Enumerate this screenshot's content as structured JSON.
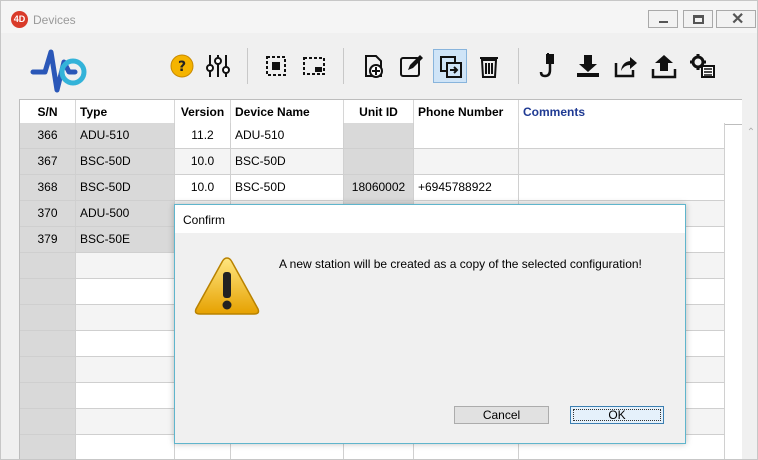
{
  "window": {
    "title": "Devices",
    "app_badge": "4D"
  },
  "grid": {
    "columns": [
      "S/N",
      "Type",
      "Version",
      "Device Name",
      "Unit ID",
      "Phone Number",
      "Comments"
    ],
    "rows": [
      {
        "sn": "366",
        "type": "ADU-510",
        "version": "11.2",
        "device_name": "ADU-510",
        "unit_id": "",
        "phone": "",
        "comments": ""
      },
      {
        "sn": "367",
        "type": "BSC-50D",
        "version": "10.0",
        "device_name": "BSC-50D",
        "unit_id": "",
        "phone": "",
        "comments": ""
      },
      {
        "sn": "368",
        "type": "BSC-50D",
        "version": "10.0",
        "device_name": "BSC-50D",
        "unit_id": "18060002",
        "phone": "+6945788922",
        "comments": ""
      },
      {
        "sn": "370",
        "type": "ADU-500",
        "version": "",
        "device_name": "",
        "unit_id": "",
        "phone": "",
        "comments": ""
      },
      {
        "sn": "379",
        "type": "BSC-50E",
        "version": "",
        "device_name": "",
        "unit_id": "",
        "phone": "",
        "comments": ""
      }
    ]
  },
  "toolbar": {
    "icons": [
      "help-icon",
      "settings-sliders-icon",
      "select-all-icon",
      "deselect-icon",
      "new-device-icon",
      "edit-icon",
      "copy-icon",
      "delete-icon",
      "connect-cable-icon",
      "download-icon",
      "export-icon",
      "upload-icon",
      "config-list-icon"
    ]
  },
  "dialog": {
    "title": "Confirm",
    "message": "A new station will be created as a copy of the selected configuration!",
    "cancel_label": "Cancel",
    "ok_label": "OK"
  },
  "colors": {
    "accent": "#1f3a93",
    "dialog_border": "#5fb5cc",
    "warning": "#f0b400"
  }
}
